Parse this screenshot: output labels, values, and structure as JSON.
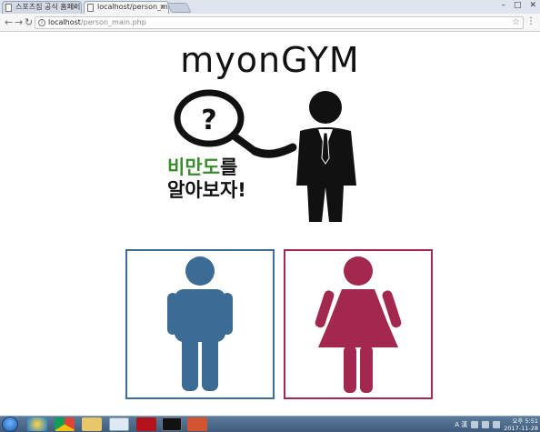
{
  "browser": {
    "tabs": [
      {
        "label": "스포츠짐 공식 홈페이지",
        "close": "×"
      },
      {
        "label": "localhost/person_main.p",
        "close": "×"
      }
    ],
    "window_controls": {
      "minimize": "–",
      "maximize": "□",
      "close": "✕"
    },
    "nav": {
      "back": "←",
      "forward": "→",
      "reload": "↻"
    },
    "url": {
      "host": "localhost",
      "path": "/person_main.php"
    },
    "star": "☆",
    "menu": "⋮"
  },
  "page": {
    "title": "myonGYM",
    "hero": {
      "line1_green": "비만도",
      "line1_black": "를",
      "line2": "알아보자!",
      "question_mark": "?"
    },
    "cards": {
      "male_color": "#3c6b93",
      "female_color": "#a3284e"
    }
  },
  "taskbar": {
    "tray_lang": "A 漢",
    "time": "오후 5:51",
    "date": "2017-11-28"
  }
}
